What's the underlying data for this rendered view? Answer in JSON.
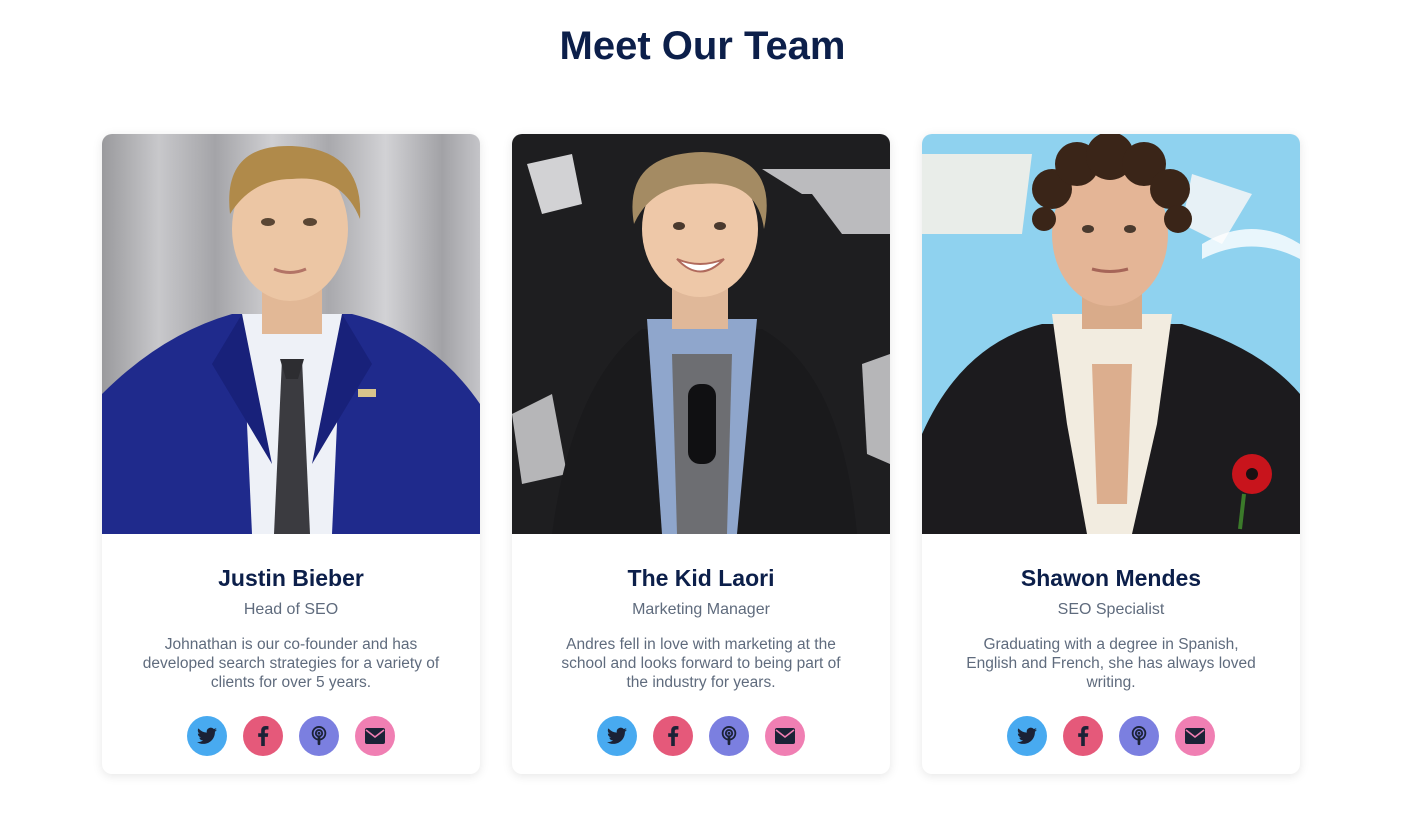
{
  "page": {
    "title": "Meet Our Team"
  },
  "colors": {
    "heading": "#0c1f4a",
    "muted": "#5f6b7d",
    "twitter": "#48aaf0",
    "facebook": "#e5597a",
    "podcast": "#7b7fe0",
    "email": "#f07fb3"
  },
  "team": [
    {
      "name": "Justin Bieber",
      "role": "Head of SEO",
      "bio": "Johnathan is our co-founder and has developed search strategies for a variety of clients for over 5 years.",
      "photo_icon": "person-photo"
    },
    {
      "name": "The Kid Laori",
      "role": "Marketing Manager",
      "bio": "Andres fell in love with marketing at the school and looks forward to being part of the industry for years.",
      "photo_icon": "person-photo"
    },
    {
      "name": "Shawon Mendes",
      "role": "SEO Specialist",
      "bio": "Graduating with a degree in Spanish, English and French, she has always loved writing.",
      "photo_icon": "person-photo"
    }
  ],
  "social_icons": [
    "twitter-icon",
    "facebook-icon",
    "podcast-icon",
    "email-icon"
  ]
}
